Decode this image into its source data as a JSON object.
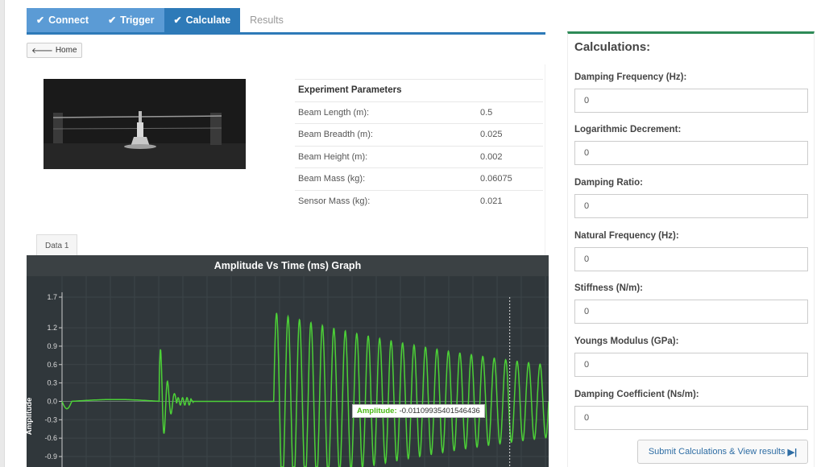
{
  "steps": [
    {
      "label": "Connect",
      "state": "done"
    },
    {
      "label": "Trigger",
      "state": "done"
    },
    {
      "label": "Calculate",
      "state": "active"
    },
    {
      "label": "Results",
      "state": "pending"
    }
  ],
  "nav": {
    "home_label": "Home"
  },
  "params": {
    "heading": "Experiment Parameters",
    "rows": [
      {
        "label": "Beam Length (m):",
        "value": "0.5"
      },
      {
        "label": "Beam Breadth (m):",
        "value": "0.025"
      },
      {
        "label": "Beam Height (m):",
        "value": "0.002"
      },
      {
        "label": "Beam Mass (kg):",
        "value": "0.06075"
      },
      {
        "label": "Sensor Mass (kg):",
        "value": "0.021"
      }
    ]
  },
  "data_tab": {
    "label": "Data 1"
  },
  "tooltip": {
    "key": "Amplitude:",
    "value": "-0.0110993540154643​6"
  },
  "chart_data": {
    "type": "line",
    "title": "Amplitude Vs Time (ms) Graph",
    "xlabel": "",
    "ylabel": "Amplitude",
    "yticks": [
      "1.7",
      "1.2",
      "0.9",
      "0.6",
      "0.3",
      "0.0",
      "-0.3",
      "-0.6",
      "-0.9"
    ],
    "ylim": [
      -1.1,
      1.8
    ],
    "grid": true,
    "series": [
      {
        "color": "#4cd137",
        "segments": [
          {
            "type": "flat",
            "t_start": 0,
            "t_end": 0.04,
            "amp": 0
          },
          {
            "type": "dip",
            "t": 0.01,
            "amp": -0.12
          },
          {
            "type": "bump",
            "t_start": 0.02,
            "t_end": 0.2,
            "amp": 0.05
          },
          {
            "type": "burst",
            "t_start": 0.2,
            "t_end": 0.27,
            "amp": 1.0,
            "decay": 0.08,
            "freq": 3
          },
          {
            "type": "flat",
            "t_start": 0.27,
            "t_end": 0.435,
            "amp": 0
          },
          {
            "type": "decay",
            "t_start": 0.435,
            "t_end": 1.0,
            "amp0": 1.4,
            "amp_end": 0.6,
            "cycles": 24
          }
        ]
      }
    ],
    "cursor_x": 0.92
  },
  "calc": {
    "title": "Calculations:",
    "fields": [
      {
        "label": "Damping Frequency (Hz):",
        "value": "0"
      },
      {
        "label": "Logarithmic Decrement:",
        "value": "0"
      },
      {
        "label": "Damping Ratio:",
        "value": "0"
      },
      {
        "label": "Natural Frequency (Hz):",
        "value": "0"
      },
      {
        "label": "Stiffness (N/m):",
        "value": "0"
      },
      {
        "label": "Youngs Modulus (GPa):",
        "value": "0"
      },
      {
        "label": "Damping Coefficient (Ns/m):",
        "value": "0"
      }
    ],
    "submit_label": "Submit Calculations & View results"
  },
  "colors": {
    "step_done": "#5b9bd5",
    "step_active": "#2e7ab8",
    "panel_accent": "#2e8b57",
    "signal": "#4cd137"
  },
  "icons": {
    "step": "check-icon",
    "home": "arrow-left-icon",
    "submit": "step-forward-icon"
  }
}
